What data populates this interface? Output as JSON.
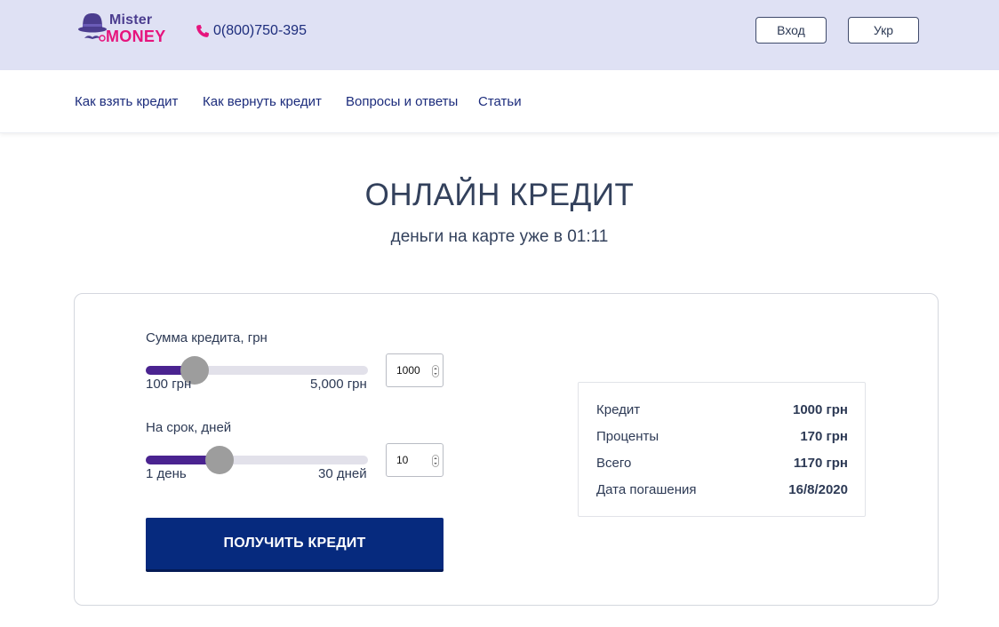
{
  "header": {
    "logo": {
      "line1": "Mister",
      "line2": "MONEY"
    },
    "phone": "0(800)750-395",
    "login_label": "Вход",
    "lang_label": "Укр",
    "colors": {
      "band": "#dfe1f4",
      "logo_purple": "#4b3d8f",
      "logo_pink": "#e6147d"
    }
  },
  "nav": {
    "items": [
      "Как взять кредит",
      "Как вернуть кредит",
      "Вопросы и ответы",
      "Статьи"
    ]
  },
  "hero": {
    "title": "ОНЛАЙН КРЕДИТ",
    "subtitle": "деньги на карте уже в 01:11"
  },
  "calculator": {
    "amount": {
      "label": "Сумма кредита, грн",
      "min_label": "100 грн",
      "max_label": "5,000 грн",
      "min": 100,
      "max": 5000,
      "value": "1000",
      "slider_fraction": 0.22
    },
    "term": {
      "label": "На срок, дней",
      "min_label": "1 день",
      "max_label": "30 дней",
      "min": 1,
      "max": 30,
      "value": "10",
      "slider_fraction": 0.33
    },
    "cta_label": "ПОЛУЧИТЬ КРЕДИТ",
    "colors": {
      "fill": "#4a2390",
      "cta": "#062a7e"
    }
  },
  "summary": {
    "rows": [
      {
        "label": "Кредит",
        "value": "1000 грн"
      },
      {
        "label": "Проценты",
        "value": "170 грн"
      },
      {
        "label": "Всего",
        "value": "1170 грн"
      },
      {
        "label": "Дата погашения",
        "value": "16/8/2020"
      }
    ]
  }
}
